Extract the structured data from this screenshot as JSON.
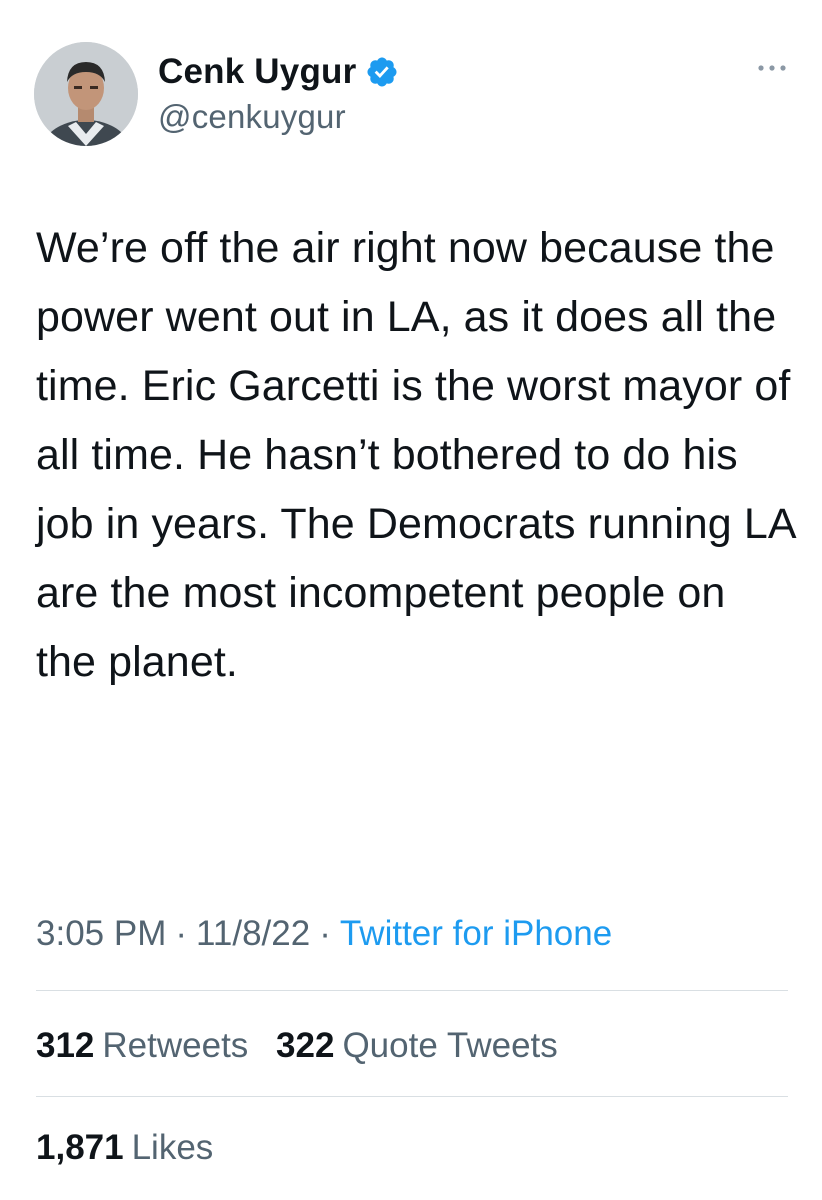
{
  "author": {
    "display_name": "Cenk Uygur",
    "handle": "@cenkuygur",
    "verified": true,
    "avatar_icon": "profile-photo"
  },
  "tweet": {
    "text": "We’re off the air right now because the power went out in LA, as it does all the time. Eric Garcetti is the worst mayor of all time. He hasn’t bothered to do his job in years. The Democrats running LA are the most incompetent people on the planet.",
    "time": "3:05 PM",
    "date": "11/8/22",
    "separator": "·",
    "source": "Twitter for iPhone"
  },
  "stats": {
    "retweets": {
      "count": "312",
      "label": "Retweets"
    },
    "quote_tweets": {
      "count": "322",
      "label": "Quote Tweets"
    },
    "likes": {
      "count": "1,871",
      "label": "Likes"
    }
  },
  "icons": {
    "more": "more-horizontal-icon",
    "verified": "verified-badge-icon"
  },
  "colors": {
    "text": "#0f1419",
    "secondary": "#536471",
    "link": "#1d9bf0",
    "verified": "#1d9bf0",
    "divider": "#d9dfe3"
  }
}
